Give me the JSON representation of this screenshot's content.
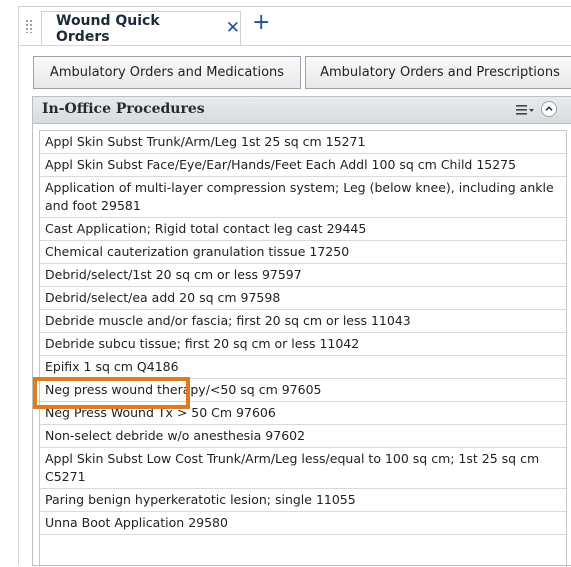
{
  "tab": {
    "label": "Wound Quick Orders"
  },
  "buttons": [
    "Ambulatory Orders and Medications",
    "Ambulatory Orders and Prescriptions"
  ],
  "panel": {
    "title": "In-Office Procedures",
    "items": [
      "Appl Skin Subst Trunk/Arm/Leg 1st 25 sq cm 15271",
      "Appl Skin Subst Face/Eye/Ear/Hands/Feet Each Addl 100 sq cm Child 15275",
      "Application of multi-layer compression system; Leg (below knee), including ankle and foot 29581",
      "Cast Application; Rigid total contact leg cast 29445",
      "Chemical cauterization granulation tissue 17250",
      "Debrid/select/1st 20 sq cm or less 97597",
      "Debrid/select/ea add 20 sq cm 97598",
      "Debride muscle and/or fascia; first 20 sq cm or less 11043",
      "Debride subcu tissue; first 20 sq cm or less 11042",
      "Epifix 1 sq cm Q4186",
      "Neg press wound therapy/<50 sq cm 97605",
      "Neg Press Wound Tx > 50 Cm 97606",
      "Non-select debride w/o anesthesia 97602",
      "Appl Skin Subst Low Cost Trunk/Arm/Leg less/equal to 100 sq cm; 1st 25 sq cm C5271",
      "Paring benign hyperkeratotic lesion; single 11055",
      "Unna Boot Application 29580"
    ]
  },
  "colors": {
    "accent": "#1f4fa3",
    "highlight": "#e07a1f"
  }
}
